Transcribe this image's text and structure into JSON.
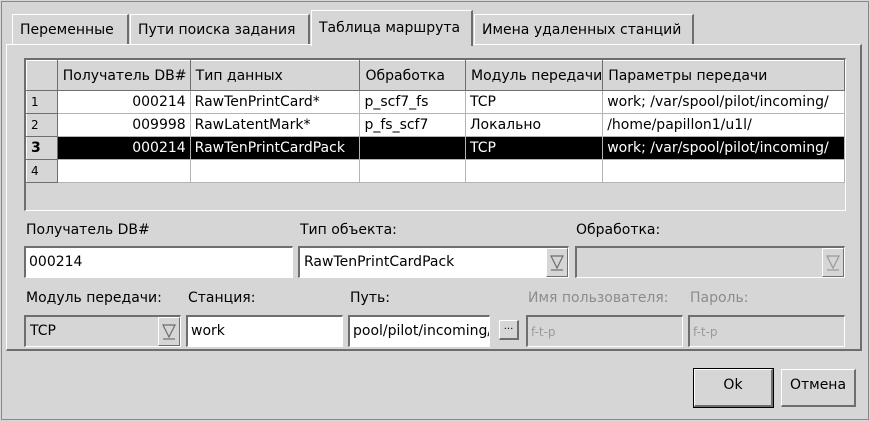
{
  "tabs": [
    {
      "label": "Переменные"
    },
    {
      "label": "Пути поиска задания"
    },
    {
      "label": "Таблица маршрута"
    },
    {
      "label": "Имена удаленных станций"
    }
  ],
  "grid": {
    "headers": [
      "Получатель DB#",
      "Тип данных",
      "Обработка",
      "Модуль передачи",
      "Параметры передачи"
    ],
    "rows": [
      {
        "n": "1",
        "c": [
          "000214",
          "RawTenPrintCard*",
          "p_scf7_fs",
          "TCP",
          "work; /var/spool/pilot/incoming/"
        ]
      },
      {
        "n": "2",
        "c": [
          "009998",
          "RawLatentMark*",
          "p_fs_scf7",
          "Локально",
          "/home/papillon1/u1l/"
        ]
      },
      {
        "n": "3",
        "c": [
          "000214",
          "RawTenPrintCardPack",
          "",
          "TCP",
          "work; /var/spool/pilot/incoming/"
        ]
      },
      {
        "n": "4",
        "c": [
          "",
          "",
          "",
          "",
          ""
        ]
      }
    ]
  },
  "form": {
    "recipient_label": "Получатель DB#",
    "recipient_value": "000214",
    "object_type_label": "Тип объекта:",
    "object_type_value": "RawTenPrintCardPack",
    "processing_label": "Обработка:",
    "processing_value": "",
    "module_label": "Модуль передачи:",
    "module_value": "TCP",
    "station_label": "Станция:",
    "station_value": "work",
    "path_label": "Путь:",
    "path_value": "pool/pilot/incoming/",
    "browse_label": "...",
    "username_label": "Имя пользователя:",
    "username_value": "f-t-p",
    "password_label": "Пароль:",
    "password_value": "f-t-p"
  },
  "buttons": {
    "ok_label": "Ok",
    "cancel_label": "Отмена"
  }
}
